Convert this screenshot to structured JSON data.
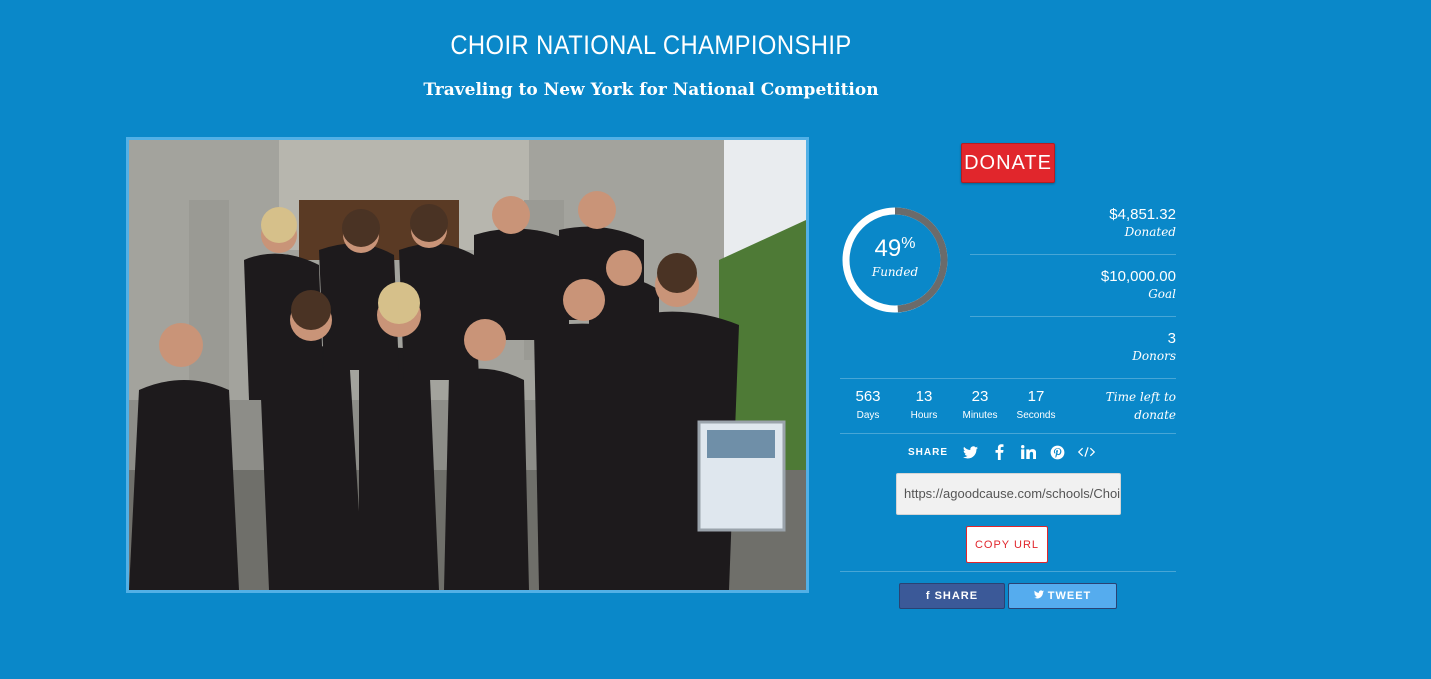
{
  "campaign": {
    "title": "CHOIR NATIONAL CHAMPIONSHIP",
    "subtitle": "Traveling to New York for National Competition"
  },
  "photo": {
    "alt": "choir-group-photo"
  },
  "donate": {
    "label": "DONATE"
  },
  "progress": {
    "percent_value": 49,
    "percent": "49",
    "percent_sign": "%",
    "label": "Funded",
    "track_color": "#ffffff",
    "fill_color": "#6b6b6b"
  },
  "stats": {
    "donated": {
      "value": "$4,851.32",
      "label": "Donated"
    },
    "goal": {
      "value": "$10,000.00",
      "label": "Goal"
    },
    "donors": {
      "value": "3",
      "label": "Donors"
    }
  },
  "countdown": {
    "days": {
      "value": "563",
      "label": "Days"
    },
    "hours": {
      "value": "13",
      "label": "Hours"
    },
    "minutes": {
      "value": "23",
      "label": "Minutes"
    },
    "seconds": {
      "value": "17",
      "label": "Seconds"
    },
    "caption_line1": "Time left to",
    "caption_line2": "donate"
  },
  "share": {
    "label": "SHARE",
    "icons": [
      "twitter-icon",
      "facebook-icon",
      "linkedin-icon",
      "pinterest-icon",
      "embed-code-icon"
    ],
    "url": "https://agoodcause.com/schools/ChoirCha",
    "copy_label": "COPY URL",
    "facebook_label": "SHARE",
    "twitter_label": "TWEET"
  },
  "colors": {
    "background": "#0a88c9",
    "donate": "#e1262c",
    "facebook": "#3b5998",
    "twitter": "#55acee"
  }
}
